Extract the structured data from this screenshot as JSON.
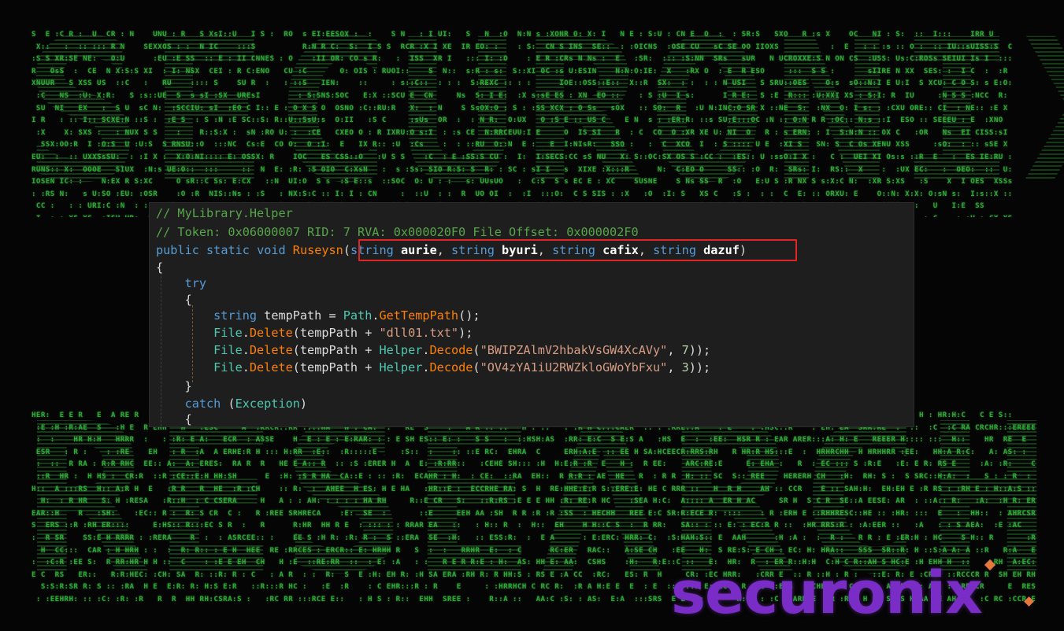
{
  "background": {
    "ascii_words": [
      "SECURONIX",
      "RESEARCH"
    ],
    "color": "#2fa838"
  },
  "code": {
    "lines": [
      {
        "segments": [
          {
            "t": "// MyLibrary.Helper",
            "c": "c-comment"
          }
        ]
      },
      {
        "segments": [
          {
            "t": "// Token: 0x06000007 RID: 7 RVA: 0x000020F0 File Offset: 0x000002F0",
            "c": "c-comment"
          }
        ]
      },
      {
        "segments": [
          {
            "t": "public",
            "c": "c-kw"
          },
          {
            "t": " ",
            "c": "c-plain"
          },
          {
            "t": "static",
            "c": "c-kw"
          },
          {
            "t": " ",
            "c": "c-plain"
          },
          {
            "t": "void",
            "c": "c-kw"
          },
          {
            "t": " ",
            "c": "c-plain"
          },
          {
            "t": "Ruseysn",
            "c": "c-method"
          },
          {
            "t": "(",
            "c": "c-plain"
          },
          {
            "t": "string",
            "c": "c-kw"
          },
          {
            "t": " ",
            "c": "c-plain"
          },
          {
            "t": "aurie",
            "c": "c-param"
          },
          {
            "t": ", ",
            "c": "c-plain"
          },
          {
            "t": "string",
            "c": "c-kw"
          },
          {
            "t": " ",
            "c": "c-plain"
          },
          {
            "t": "byuri",
            "c": "c-param"
          },
          {
            "t": ", ",
            "c": "c-plain"
          },
          {
            "t": "string",
            "c": "c-kw"
          },
          {
            "t": " ",
            "c": "c-plain"
          },
          {
            "t": "cafix",
            "c": "c-param"
          },
          {
            "t": ", ",
            "c": "c-plain"
          },
          {
            "t": "string",
            "c": "c-kw"
          },
          {
            "t": " ",
            "c": "c-plain"
          },
          {
            "t": "dazuf",
            "c": "c-param"
          },
          {
            "t": ")",
            "c": "c-plain"
          }
        ]
      },
      {
        "segments": [
          {
            "t": "{",
            "c": "c-plain"
          }
        ]
      },
      {
        "segments": [
          {
            "t": "    ",
            "c": "c-plain"
          },
          {
            "t": "try",
            "c": "c-kw"
          }
        ]
      },
      {
        "segments": [
          {
            "t": "    {",
            "c": "c-plain"
          }
        ]
      },
      {
        "segments": [
          {
            "t": "        ",
            "c": "c-plain"
          },
          {
            "t": "string",
            "c": "c-kw"
          },
          {
            "t": " tempPath = ",
            "c": "c-plain"
          },
          {
            "t": "Path",
            "c": "c-type"
          },
          {
            "t": ".",
            "c": "c-plain"
          },
          {
            "t": "GetTempPath",
            "c": "c-method"
          },
          {
            "t": "();",
            "c": "c-plain"
          }
        ]
      },
      {
        "segments": [
          {
            "t": "        ",
            "c": "c-plain"
          },
          {
            "t": "File",
            "c": "c-type"
          },
          {
            "t": ".",
            "c": "c-plain"
          },
          {
            "t": "Delete",
            "c": "c-method"
          },
          {
            "t": "(tempPath + ",
            "c": "c-plain"
          },
          {
            "t": "\"dll01.txt\"",
            "c": "c-str"
          },
          {
            "t": ");",
            "c": "c-plain"
          }
        ]
      },
      {
        "segments": [
          {
            "t": "        ",
            "c": "c-plain"
          },
          {
            "t": "File",
            "c": "c-type"
          },
          {
            "t": ".",
            "c": "c-plain"
          },
          {
            "t": "Delete",
            "c": "c-method"
          },
          {
            "t": "(tempPath + ",
            "c": "c-plain"
          },
          {
            "t": "Helper",
            "c": "c-type"
          },
          {
            "t": ".",
            "c": "c-plain"
          },
          {
            "t": "Decode",
            "c": "c-method"
          },
          {
            "t": "(",
            "c": "c-plain"
          },
          {
            "t": "\"BWIPZAlmV2hbakVsGW4XcAVy\"",
            "c": "c-str"
          },
          {
            "t": ", ",
            "c": "c-plain"
          },
          {
            "t": "7",
            "c": "c-num"
          },
          {
            "t": "));",
            "c": "c-plain"
          }
        ]
      },
      {
        "segments": [
          {
            "t": "        ",
            "c": "c-plain"
          },
          {
            "t": "File",
            "c": "c-type"
          },
          {
            "t": ".",
            "c": "c-plain"
          },
          {
            "t": "Delete",
            "c": "c-method"
          },
          {
            "t": "(tempPath + ",
            "c": "c-plain"
          },
          {
            "t": "Helper",
            "c": "c-type"
          },
          {
            "t": ".",
            "c": "c-plain"
          },
          {
            "t": "Decode",
            "c": "c-method"
          },
          {
            "t": "(",
            "c": "c-plain"
          },
          {
            "t": "\"OV4zYA1iU2RWZkloGWoYbFxu\"",
            "c": "c-str"
          },
          {
            "t": ", ",
            "c": "c-plain"
          },
          {
            "t": "3",
            "c": "c-num"
          },
          {
            "t": "));",
            "c": "c-plain"
          }
        ]
      },
      {
        "segments": [
          {
            "t": "    }",
            "c": "c-plain"
          }
        ]
      },
      {
        "segments": [
          {
            "t": "    ",
            "c": "c-plain"
          },
          {
            "t": "catch",
            "c": "c-kw"
          },
          {
            "t": " (",
            "c": "c-plain"
          },
          {
            "t": "Exception",
            "c": "c-type"
          },
          {
            "t": ")",
            "c": "c-plain"
          }
        ]
      },
      {
        "segments": [
          {
            "t": "    {",
            "c": "c-plain"
          }
        ]
      }
    ]
  },
  "highlight": {
    "label": "method-parameters",
    "color": "#e12424"
  },
  "logo": {
    "text": "securonix",
    "color": "#7a2cc6",
    "accent": "#e6783c"
  }
}
